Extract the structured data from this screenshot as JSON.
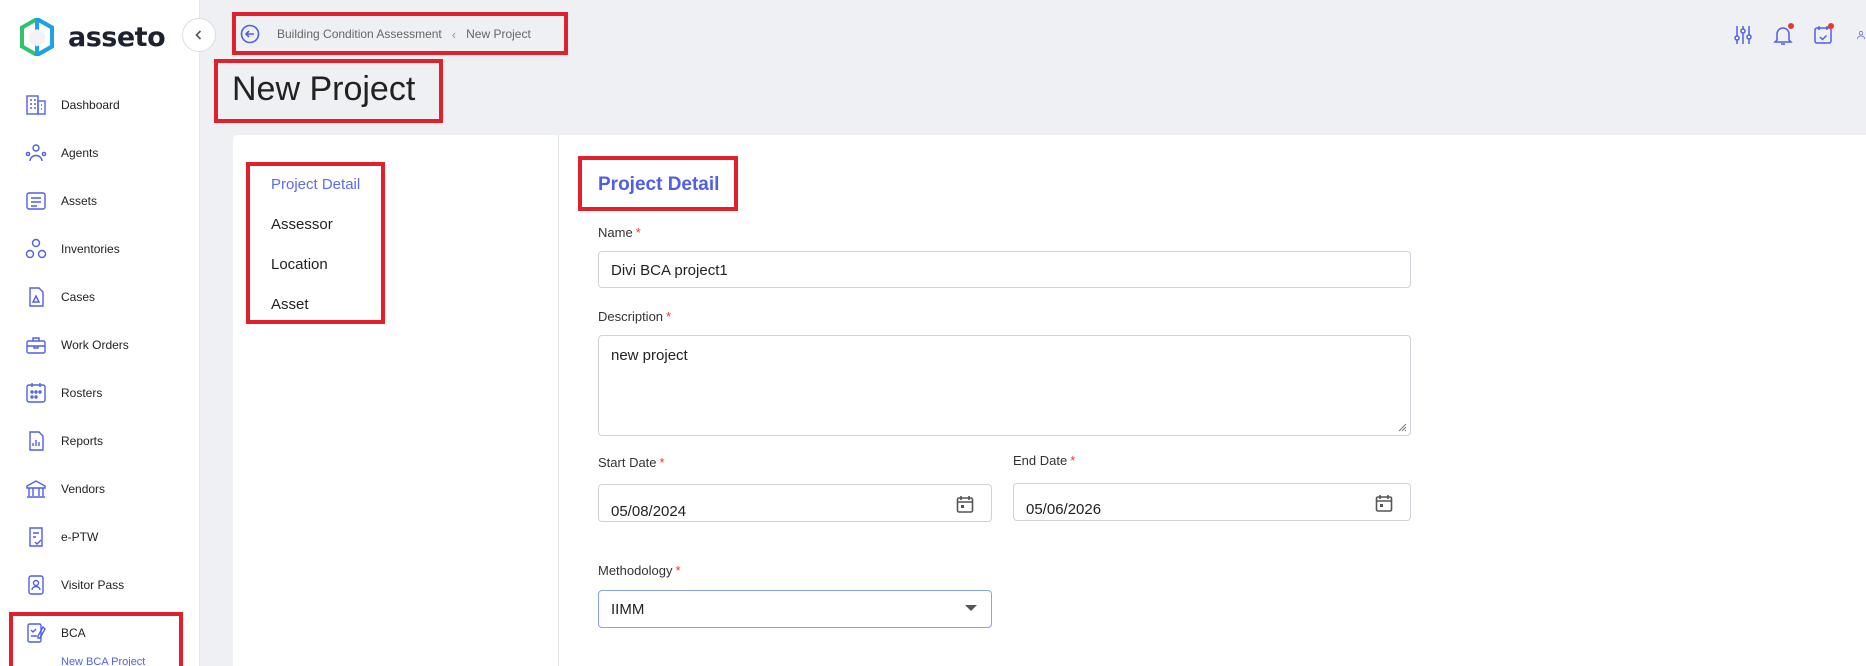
{
  "app": {
    "logo_text": "asseto",
    "colors": {
      "accent": "#4f5fe6",
      "highlight": "#e0202b",
      "required": "#e53935"
    }
  },
  "sidebar": {
    "items": [
      {
        "label": "Dashboard",
        "icon": "building-icon"
      },
      {
        "label": "Agents",
        "icon": "agents-icon"
      },
      {
        "label": "Assets",
        "icon": "assets-icon"
      },
      {
        "label": "Inventories",
        "icon": "inventories-icon"
      },
      {
        "label": "Cases",
        "icon": "cases-icon"
      },
      {
        "label": "Work Orders",
        "icon": "toolbox-icon"
      },
      {
        "label": "Rosters",
        "icon": "rosters-icon"
      },
      {
        "label": "Reports",
        "icon": "reports-icon"
      },
      {
        "label": "Vendors",
        "icon": "vendors-icon"
      },
      {
        "label": "e-PTW",
        "icon": "eptw-icon"
      },
      {
        "label": "Visitor Pass",
        "icon": "visitor-pass-icon"
      },
      {
        "label": "BCA",
        "icon": "bca-icon"
      }
    ],
    "sub_item_label": "New BCA Project"
  },
  "header": {
    "breadcrumb": {
      "parent": "Building Condition Assessment",
      "current": "New Project"
    },
    "page_title": "New Project",
    "icons": [
      "filter-sliders-icon",
      "notification-bell-icon",
      "task-check-icon",
      "user-icon"
    ]
  },
  "tabs": [
    {
      "label": "Project Detail",
      "active": true
    },
    {
      "label": "Assessor",
      "active": false
    },
    {
      "label": "Location",
      "active": false
    },
    {
      "label": "Asset",
      "active": false
    }
  ],
  "form": {
    "section_title": "Project Detail",
    "name": {
      "label": "Name",
      "value": "Divi BCA project1"
    },
    "description": {
      "label": "Description",
      "value": "new project"
    },
    "start_date": {
      "label": "Start Date",
      "value": "05/08/2024"
    },
    "end_date": {
      "label": "End Date",
      "value": "05/06/2026"
    },
    "methodology": {
      "label": "Methodology",
      "value": "IIMM"
    },
    "required_marker": "*"
  }
}
